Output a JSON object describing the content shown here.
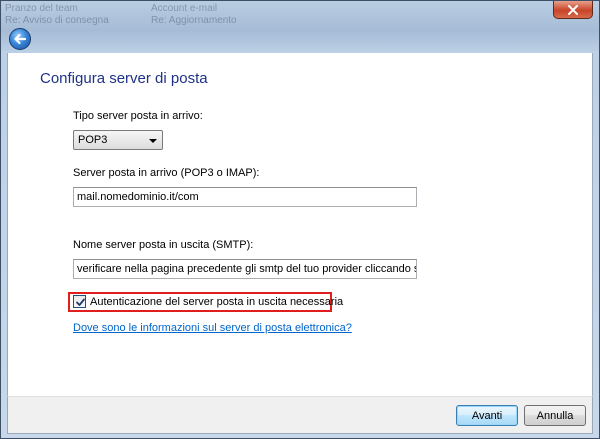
{
  "window": {
    "background_titles": [
      "Pranzo del team",
      "Re: Avviso di consegna",
      "Account e-mail",
      "Re: Aggiornamento"
    ]
  },
  "page": {
    "title": "Configura server di posta"
  },
  "incoming_type": {
    "label": "Tipo server posta in arrivo:",
    "selected": "POP3"
  },
  "incoming_server": {
    "label": "Server posta in arrivo (POP3 o IMAP):",
    "value": "mail.nomedominio.it/com"
  },
  "outgoing_server": {
    "label": "Nome server posta in uscita (SMTP):",
    "value": "verificare nella pagina precedente gli smtp del tuo provider cliccando sul link"
  },
  "auth_checkbox": {
    "label": "Autenticazione del server posta in uscita necessaria",
    "checked": true
  },
  "help_link": {
    "text": "Dove sono le informazioni sul server di posta elettronica?"
  },
  "footer": {
    "next_label": "Avanti",
    "cancel_label": "Annulla"
  },
  "colors": {
    "title": "#1e3287",
    "link": "#0066cc",
    "highlight": "#e01e1e"
  },
  "icons": {
    "back": "back-arrow-icon",
    "close": "close-icon",
    "dropdown": "chevron-down-icon",
    "check": "checkmark-icon"
  }
}
